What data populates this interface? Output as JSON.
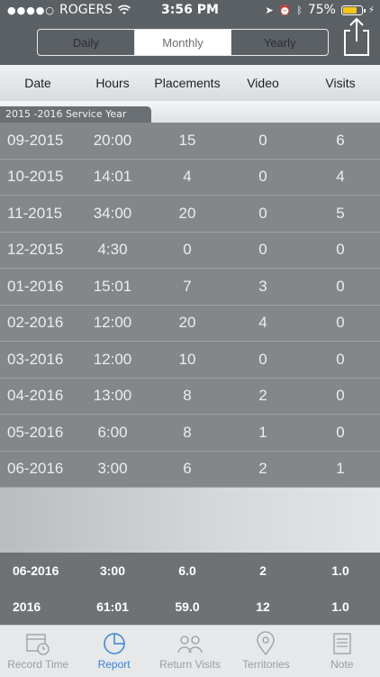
{
  "status": {
    "carrier": "ROGERS",
    "time": "3:56 PM",
    "battery": "75%",
    "battery_level": 0.75
  },
  "segmented": {
    "tabs": [
      "Daily",
      "Monthly",
      "Yearly"
    ],
    "active": "Monthly"
  },
  "table": {
    "headers": [
      "Date",
      "Hours",
      "Placements",
      "Video",
      "Visits"
    ],
    "group_label": "2015 -2016 Service Year",
    "rows": [
      [
        "09-2015",
        "20:00",
        "15",
        "0",
        "6"
      ],
      [
        "10-2015",
        "14:01",
        "4",
        "0",
        "4"
      ],
      [
        "11-2015",
        "34:00",
        "20",
        "0",
        "5"
      ],
      [
        "12-2015",
        "4:30",
        "0",
        "0",
        "0"
      ],
      [
        "01-2016",
        "15:01",
        "7",
        "3",
        "0"
      ],
      [
        "02-2016",
        "12:00",
        "20",
        "4",
        "0"
      ],
      [
        "03-2016",
        "12:00",
        "10",
        "0",
        "0"
      ],
      [
        "04-2016",
        "13:00",
        "8",
        "2",
        "0"
      ],
      [
        "05-2016",
        "6:00",
        "8",
        "1",
        "0"
      ],
      [
        "06-2016",
        "3:00",
        "6",
        "2",
        "1"
      ]
    ]
  },
  "summary": {
    "rows": [
      [
        "06-2016",
        "3:00",
        "6.0",
        "2",
        "1.0"
      ],
      [
        "2016",
        "61:01",
        "59.0",
        "12",
        "1.0"
      ]
    ]
  },
  "tabbar": {
    "items": [
      {
        "label": "Record Time",
        "icon": "calendar-clock-icon"
      },
      {
        "label": "Report",
        "icon": "pie-chart-icon"
      },
      {
        "label": "Return Visits",
        "icon": "people-icon"
      },
      {
        "label": "Territories",
        "icon": "map-pin-icon"
      },
      {
        "label": "Note",
        "icon": "note-icon"
      }
    ],
    "active": "Report"
  },
  "colors": {
    "accent": "#3a84d8",
    "battery": "#f5c518"
  }
}
